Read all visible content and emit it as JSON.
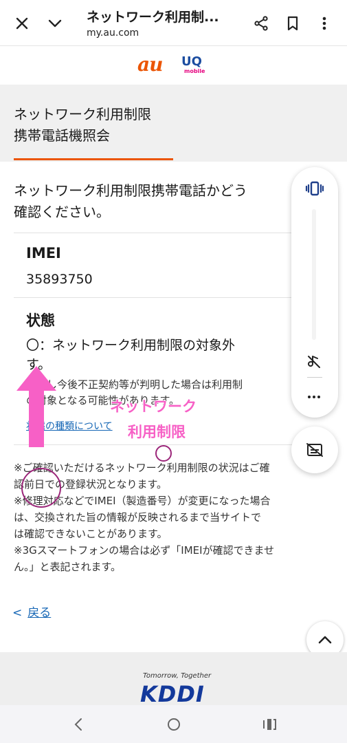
{
  "browser": {
    "title": "ネットワーク利用制...",
    "url": "my.au.com",
    "icons": [
      "close-icon",
      "chevron-down-icon",
      "share-icon",
      "bookmark-icon",
      "more-vertical-icon"
    ]
  },
  "brand": {
    "au": "au",
    "uq": "UQ",
    "uq_sub": "mobile",
    "au_color": "#eb5505",
    "uq_color": "#1c4da0"
  },
  "page_heading": {
    "line1": "ネットワーク利用制限",
    "line2": "携帯電話機照会"
  },
  "intro_text": "ネットワーク利用制限携帯電話かどう\n確認ください。",
  "result": {
    "imei_label": "IMEI",
    "imei_value": "35893750",
    "status_label": "状態",
    "status_value": "〇：ネットワーク利用制限の対象外\nす。",
    "status_note": "ただし今後不正契約等が判明した場合は利用制\nの対象となる可能性があります。",
    "status_link": "状態の種類について"
  },
  "remarks": "※ご確認いただけるネットワーク利用制限の状況はご確\n認前日での登録状況となります。\n※修理対応などでIMEI（製造番号）が変更になった場合\nは、交換された旨の情報が反映されるまで当サイトで\nは確認できないことがあります。\n※3Gスマートフォンの場合は必ず「IMEIが確認できませ\nん。」と表記されます。",
  "back_link": {
    "arrow": "<",
    "label": "戻る"
  },
  "footer": {
    "tagline": "Tomorrow, Together",
    "logo": "KDDI"
  },
  "annotation": {
    "line1": "ネットワーク",
    "line2": "利用制限",
    "color": "#f760c6"
  },
  "volume_panel": {
    "level": 0.0
  },
  "accent_color": "#eb5505"
}
